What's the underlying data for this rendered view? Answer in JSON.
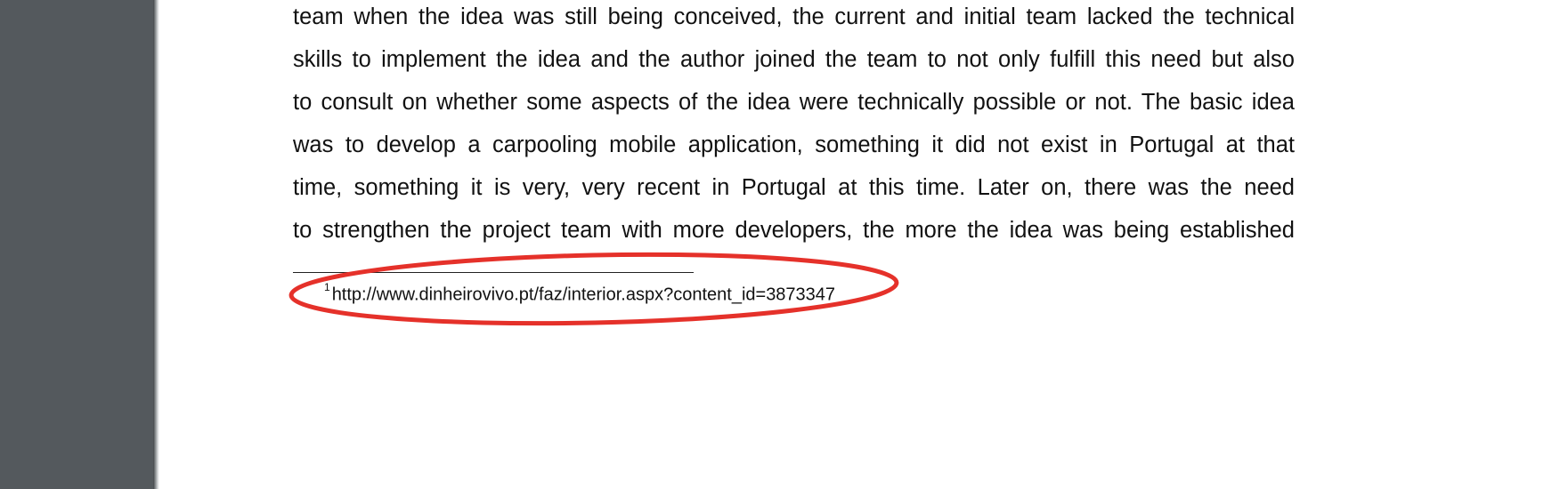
{
  "viewer": {
    "sidebar_color": "#54595d",
    "page_color": "#ffffff"
  },
  "document": {
    "body_lines": [
      "team when the idea was still being conceived, the current and initial team lacked the technical",
      "skills to implement the idea and the author joined the team to not only fulfill this need but also",
      "to consult on whether some aspects of the idea were technically possible or not.  The basic idea",
      "was to develop a carpooling mobile application, something it did not exist in Portugal at that",
      "time, something it is very, very recent in Portugal at this time.  Later on, there was the need",
      "to strengthen the project team with more developers, the more the idea was being established"
    ],
    "footnote": {
      "marker": "1",
      "text": "http://www.dinheirovivo.pt/faz/interior.aspx?content_id=3873347"
    }
  },
  "annotation": {
    "shape": "ellipse",
    "color": "#e5312a",
    "target": "footnote"
  }
}
